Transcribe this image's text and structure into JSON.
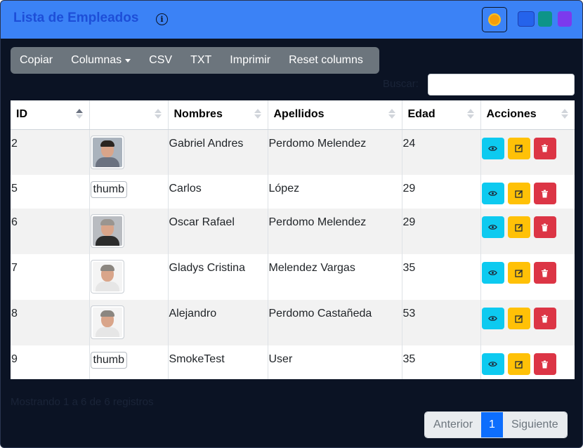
{
  "app": {
    "title": "Lista de Empleados",
    "info_icon": "info-icon",
    "theme_icon": "sun-icon",
    "swatches": [
      "#2563eb",
      "#0d9488",
      "#7c3aed"
    ]
  },
  "toolbar": {
    "copy": "Copiar",
    "columns": "Columnas",
    "csv": "CSV",
    "txt": "TXT",
    "print": "Imprimir",
    "reset": "Reset columns"
  },
  "search": {
    "label": "Buscar:",
    "value": ""
  },
  "table": {
    "headers": {
      "id": "ID",
      "photo": "",
      "names": "Nombres",
      "surnames": "Apellidos",
      "age": "Edad",
      "actions": "Acciones"
    },
    "rows": [
      {
        "id": "2",
        "photo": "image",
        "alt": "thumb",
        "names": "Gabriel Andres",
        "surnames": "Perdomo Melendez",
        "age": "24"
      },
      {
        "id": "5",
        "photo": "broken",
        "alt": "thumb",
        "names": "Carlos",
        "surnames": "López",
        "age": "29"
      },
      {
        "id": "6",
        "photo": "image",
        "alt": "thumb",
        "names": "Oscar Rafael",
        "surnames": "Perdomo Melendez",
        "age": "29"
      },
      {
        "id": "7",
        "photo": "image",
        "alt": "thumb",
        "names": "Gladys Cristina",
        "surnames": "Melendez Vargas",
        "age": "35"
      },
      {
        "id": "8",
        "photo": "image",
        "alt": "thumb",
        "names": "Alejandro",
        "surnames": "Perdomo Castañeda",
        "age": "53"
      },
      {
        "id": "9",
        "photo": "broken",
        "alt": "thumb",
        "names": "SmokeTest",
        "surnames": "User",
        "age": "35"
      }
    ],
    "action_icons": [
      "eye-icon",
      "pencil-square-icon",
      "trash-icon"
    ]
  },
  "footer": {
    "info": "Mostrando 1 a 6 de 6 registros",
    "prev": "Anterior",
    "page": "1",
    "next": "Siguiente"
  },
  "colors": {
    "header": "#3b82f6",
    "background": "#0b1324",
    "view": "#0dcaf0",
    "edit": "#ffc107",
    "delete": "#dc3545",
    "page_active": "#0d6efd"
  }
}
